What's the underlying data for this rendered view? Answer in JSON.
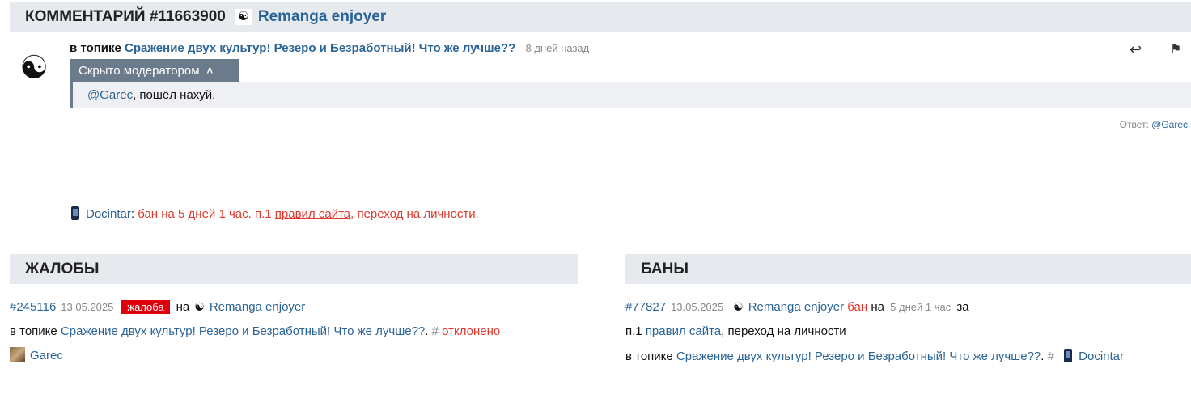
{
  "header": {
    "title": "КОММЕНТАРИЙ #11663900",
    "author": "Remanga enjoyer",
    "yinyang_icon": "yin-yang-icon"
  },
  "comment": {
    "in_topic_label": "в топике",
    "topic": "Сражение двух культур! Резеро и Безработный! Что же лучше??",
    "time_ago": "8 дней назад",
    "hidden_label": "Скрыто модератором",
    "mention": "@Garec",
    "text": ", пошёл нахуй.",
    "reply_to_label": "Ответ:",
    "reply_to_user": "@Garec"
  },
  "mod_note": {
    "moderator": "Docintar",
    "colon": ":",
    "text_before": "бан на 5 дней 1 час. п.1",
    "rules_link": "правил сайта",
    "text_after": ", переход на личности."
  },
  "complaints": {
    "title": "ЖАЛОБЫ",
    "id": "#245116",
    "date": "13.05.2025",
    "badge": "жалоба",
    "on_label": "на",
    "target": "Remanga enjoyer",
    "in_topic_label": "в топике",
    "topic": "Сражение двух культур! Резеро и Безработный! Что же лучше??",
    "dot": ".",
    "hash": "#",
    "status": "отклонено",
    "reporter": "Garec"
  },
  "bans": {
    "title": "БАНЫ",
    "id": "#77827",
    "date": "13.05.2025",
    "user": "Remanga enjoyer",
    "ban_label": "бан",
    "on_label": "на",
    "duration": "5 дней 1 час",
    "for_label": "за",
    "rule_prefix": "п.1",
    "rules_link": "правил сайта",
    "reason": ", переход на личности",
    "in_topic_label": "в топике",
    "topic": "Сражение двух культур! Резеро и Безработный! Что же лучше??",
    "dot": ".",
    "hash": "#",
    "moderator": "Docintar"
  },
  "icons": {
    "reply": "reply-icon",
    "flag": "flag-icon",
    "phone": "phone-icon",
    "chevron": "chevron-up-icon"
  },
  "colors": {
    "link": "#2a6496",
    "red": "#e0382c",
    "badge": "#e0000b",
    "header_bg": "#e6e9ee",
    "mod_tab": "#6b7b8c"
  }
}
